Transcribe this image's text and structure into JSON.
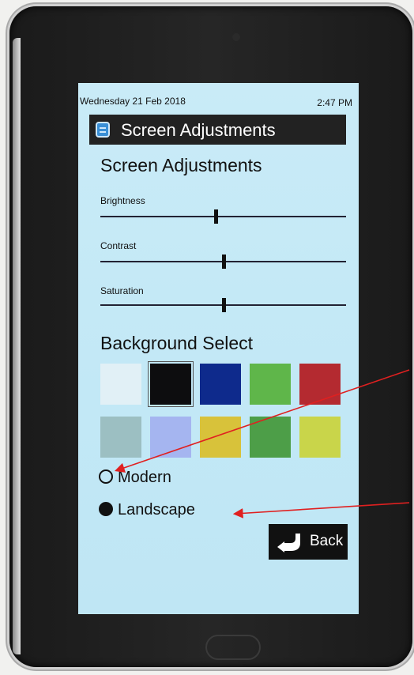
{
  "status": {
    "date": "Wednesday 21 Feb 2018",
    "time": "2:47 PM"
  },
  "titlebar": {
    "icon": "screen-settings-icon",
    "title": "Screen Adjustments"
  },
  "adjustments": {
    "heading": "Screen Adjustments",
    "sliders": [
      {
        "label": "Brightness",
        "value": 0.47
      },
      {
        "label": "Contrast",
        "value": 0.5
      },
      {
        "label": "Saturation",
        "value": 0.5
      }
    ]
  },
  "background": {
    "heading": "Background Select",
    "swatches": [
      {
        "name": "swatch-white",
        "color": "#e1f0f6",
        "selected": false
      },
      {
        "name": "swatch-black",
        "color": "#0d0d0f",
        "selected": true
      },
      {
        "name": "swatch-navy",
        "color": "#0e2a8c",
        "selected": false
      },
      {
        "name": "swatch-green",
        "color": "#5fb64a",
        "selected": false
      },
      {
        "name": "swatch-red",
        "color": "#b42a30",
        "selected": false
      },
      {
        "name": "swatch-grey-teal",
        "color": "#9cbfc2",
        "selected": false
      },
      {
        "name": "swatch-lavender",
        "color": "#a5b5f0",
        "selected": false
      },
      {
        "name": "swatch-mustard",
        "color": "#d8c23a",
        "selected": false
      },
      {
        "name": "swatch-forest-green",
        "color": "#4d9e48",
        "selected": false
      },
      {
        "name": "swatch-yellow-green",
        "color": "#c9d54a",
        "selected": false
      }
    ],
    "options": [
      {
        "label": "Modern",
        "checked": false
      },
      {
        "label": "Landscape",
        "checked": true
      }
    ]
  },
  "back_button": {
    "label": "Back",
    "icon": "return-arrow-icon"
  },
  "annotation_color": "#e02020"
}
